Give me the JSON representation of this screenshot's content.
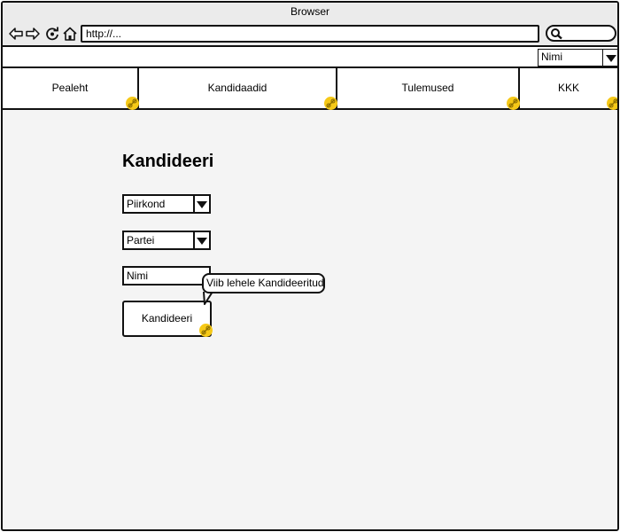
{
  "browser": {
    "title": "Browser",
    "address": "http://...",
    "icons": [
      "back-arrow-icon",
      "forward-arrow-icon",
      "reload-icon",
      "home-icon",
      "search-icon"
    ]
  },
  "user": {
    "selected": "Nimi"
  },
  "tabs": [
    {
      "label": "Pealeht"
    },
    {
      "label": "Kandidaadid"
    },
    {
      "label": "Tulemused"
    },
    {
      "label": "KKK"
    }
  ],
  "form": {
    "title": "Kandideeri",
    "district_selected": "Piirkond",
    "party_selected": "Partei",
    "name_value": "Nimi",
    "submit_label": "Kandideeri"
  },
  "tooltip": {
    "text": "Viib lehele Kandideeritud"
  },
  "colors": {
    "link_badge": "#f6c917",
    "outline": "#111111",
    "background": "#f4f4f4"
  }
}
